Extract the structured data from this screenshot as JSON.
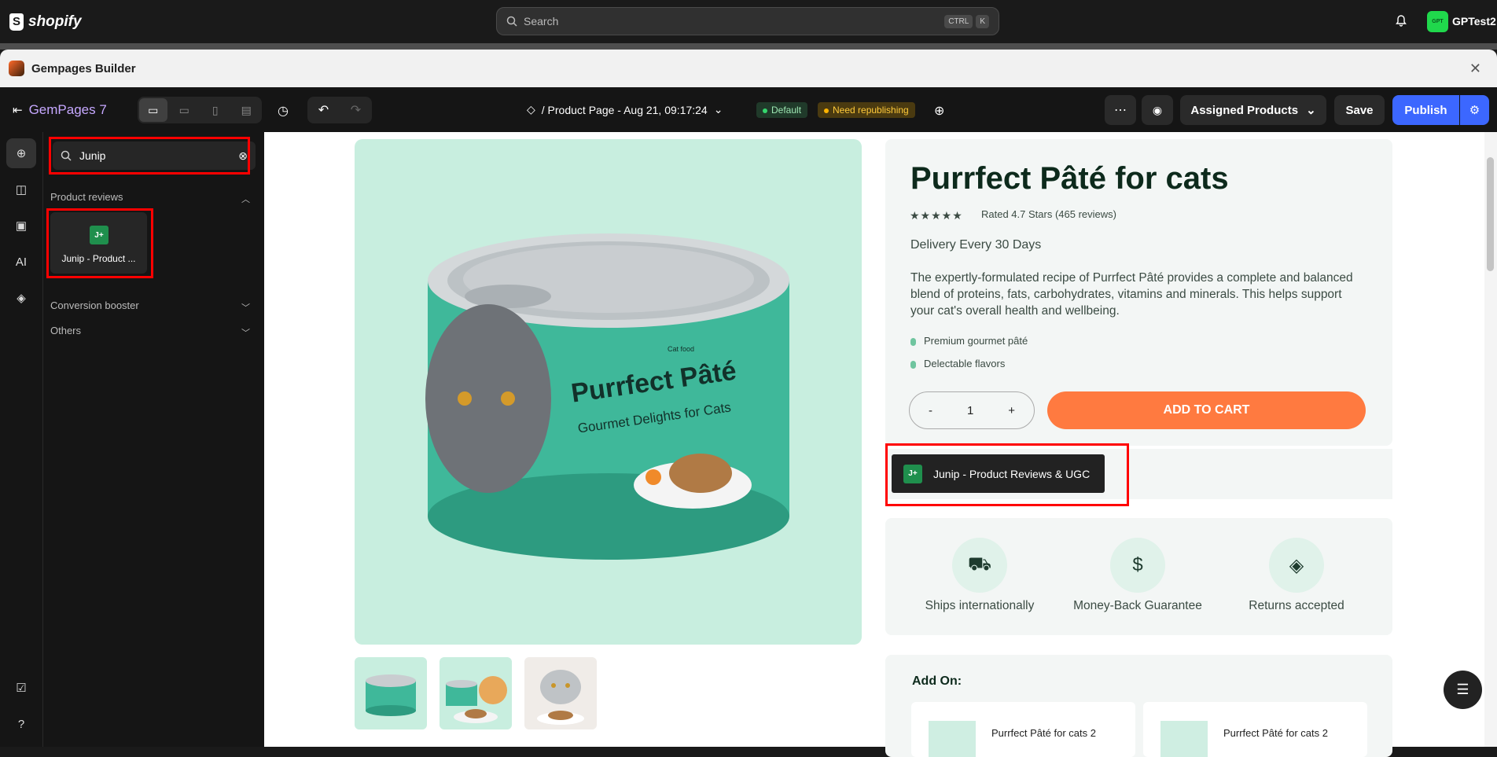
{
  "shopify": {
    "logo_text": "shopify",
    "search_placeholder": "Search",
    "kbd1": "CTRL",
    "kbd2": "K",
    "avatar_text": "GPT",
    "store_name": "GPTest2"
  },
  "app": {
    "title": "Gempages Builder"
  },
  "toolbar": {
    "brand": "GemPages 7",
    "page_name": "/ Product Page - Aug 21, 09:17:24",
    "badge_default": "Default",
    "badge_warn": "Need republishing",
    "assigned_products": "Assigned Products",
    "save": "Save",
    "publish": "Publish"
  },
  "sidebar": {
    "search_value": "Junip",
    "sections": {
      "product_reviews": "Product reviews",
      "conversion_booster": "Conversion booster",
      "others": "Others"
    },
    "junip_card_label": "Junip - Product ...",
    "junip_icon_text": "J+"
  },
  "product": {
    "title": "Purrfect Pâté for cats",
    "stars": "★★★★★",
    "rating": "Rated 4.7 Stars (465 reviews)",
    "rating_value": 4.7,
    "delivery": "Delivery Every 30 Days",
    "description": "The expertly-formulated recipe of Purrfect Pâté provides a complete and balanced blend of proteins, fats, carbohydrates, vitamins and minerals. This helps support your cat's overall health and wellbeing.",
    "bullets": [
      "Premium gourmet pâté",
      "Delectable flavors"
    ],
    "qty_minus": "-",
    "qty_value": "1",
    "qty_plus": "+",
    "add_to_cart": "ADD TO CART",
    "can_brand": "Purrfect Pâté",
    "can_tagline": "Gourmet Delights for Cats",
    "can_label_top": "Cat food"
  },
  "junip_widget": {
    "label": "Junip - Product Reviews & UGC"
  },
  "features": [
    {
      "label": "Ships internationally",
      "icon": "truck-icon"
    },
    {
      "label": "Money-Back Guarantee",
      "icon": "money-back-icon"
    },
    {
      "label": "Returns accepted",
      "icon": "box-icon"
    }
  ],
  "addon": {
    "title": "Add On:",
    "items": [
      "Purrfect Pâté for cats 2",
      "Purrfect Pâté for cats 2"
    ]
  }
}
